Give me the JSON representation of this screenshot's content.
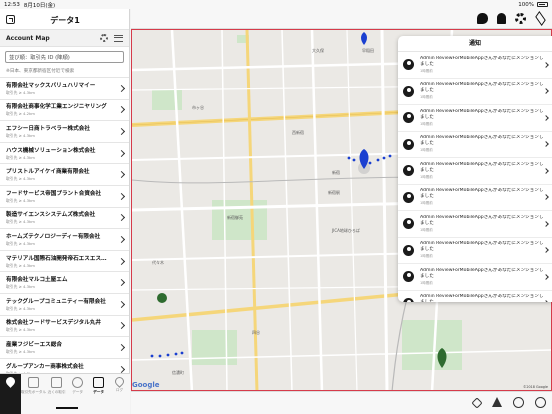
{
  "status": {
    "time": "12:53",
    "date": "8月10日(金)",
    "battery": "100%"
  },
  "header": {
    "title": "データ1"
  },
  "sidebar": {
    "account_label": "Account Map",
    "search_text": "並び順：取引先 ID (降順)",
    "hint": "※日本、東京都新宿区付近で検索",
    "items": [
      {
        "name": "有限会社マックスバリュハリマイー",
        "dist": "取引先 ≥ 4.3km"
      },
      {
        "name": "有限会社商事化学工業エンジニヤリング",
        "dist": "取引先 ≥ 4.2km"
      },
      {
        "name": "エフシー日商トラベラー株式会社",
        "dist": "取引先 ≥ 4.3km"
      },
      {
        "name": "ハウス機械ソリューション株式会社",
        "dist": "取引先 ≥ 4.3km"
      },
      {
        "name": "プリストルアイケイ商業有限会社",
        "dist": "取引先 ≥ 4.3km"
      },
      {
        "name": "フードサービス帝国プラント合資会社",
        "dist": "取引先 ≥ 4.3km"
      },
      {
        "name": "製造サイエンスシステムズ株式会社",
        "dist": "取引先 ≥ 4.3km"
      },
      {
        "name": "ホームズテクノロジーディー有限会社",
        "dist": "取引先 ≥ 4.3km"
      },
      {
        "name": "マテリアル国際石油開発帝石エスエス…",
        "dist": "取引先 ≥ 4.3km"
      },
      {
        "name": "有限会社マルコ土屋エム",
        "dist": "取引先 ≥ 4.3km"
      },
      {
        "name": "テックグループコミュニティー有限会社",
        "dist": "取引先 ≥ 4.3km"
      },
      {
        "name": "株式会社フードサービスデジタル丸井",
        "dist": "取引先 ≥ 4.3km"
      },
      {
        "name": "産業フジビーエス総合",
        "dist": "取引先 ≥ 4.3km"
      },
      {
        "name": "グループアンカー商事株式会社",
        "dist": "取引先 ≥ 4.3km"
      }
    ]
  },
  "tabs": [
    {
      "label": "取引先ポータル"
    },
    {
      "label": "近くの取引"
    },
    {
      "label": "データ"
    },
    {
      "label": "データ"
    },
    {
      "label": "ログ"
    }
  ],
  "notifications": {
    "title": "通知",
    "items": [
      {
        "message": "Admin ReviewForMobileAppさんがあなたにメンションしました",
        "date": "1時間前"
      },
      {
        "message": "Admin ReviewForMobileAppさんがあなたにメンションしました",
        "date": "1時間前"
      },
      {
        "message": "Admin ReviewForMobileAppさんがあなたにメンションしました",
        "date": "1時間前"
      },
      {
        "message": "Admin ReviewForMobileAppさんがあなたにメンションしました",
        "date": "1時間前"
      },
      {
        "message": "Admin ReviewForMobileAppさんがあなたにメンションしました",
        "date": "1時間前"
      },
      {
        "message": "Admin ReviewForMobileAppさんがあなたにメンションしました",
        "date": "1時間前"
      },
      {
        "message": "Admin ReviewForMobileAppさんがあなたにメンションしました",
        "date": "1時間前"
      },
      {
        "message": "Admin ReviewForMobileAppさんがあなたにメンションしました",
        "date": "1時間前"
      },
      {
        "message": "Admin ReviewForMobileAppさんがあなたにメンションしました",
        "date": "1時間前"
      },
      {
        "message": "Admin ReviewForMobileAppさんがあなたにメンションしました",
        "date": "1時間前"
      }
    ]
  },
  "map": {
    "google": "Google",
    "copyright": "©2018 Google",
    "labels": [
      "新宿",
      "新宿御苑",
      "代々木",
      "西新宿",
      "新宿駅",
      "大久保",
      "早稲田",
      "市ヶ谷",
      "四谷",
      "信濃町",
      "JICA地球ひろば"
    ]
  }
}
